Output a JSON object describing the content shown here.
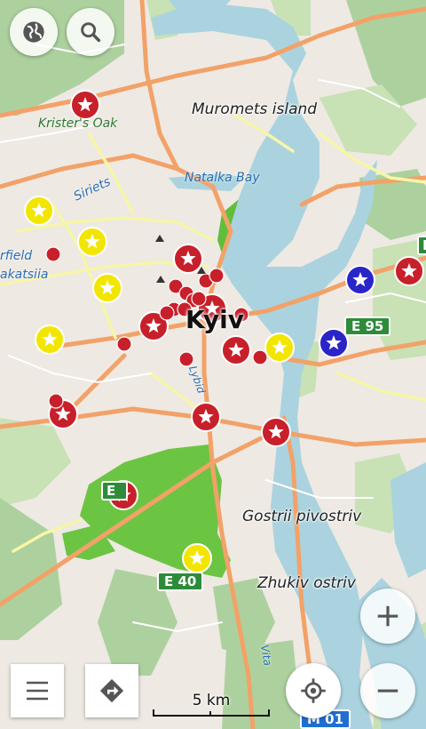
{
  "labels": {
    "muromets": "Muromets island",
    "kristers_oak": "Krister's Oak",
    "natalka_bay": "Natalka Bay",
    "siriets": "Siriets",
    "field": "rfield",
    "akatsiia": "akatsiia",
    "kyiv": "Kyiv",
    "lybid": "Lybid",
    "gostrii": "Gostrii pivostriv",
    "zhukiv": "Zhukiv ostriv",
    "vita": "Vita",
    "edge_m": "M"
  },
  "road_shields": {
    "e95": "E 95",
    "e40": "E 40",
    "e_left": "E",
    "m01": "M 01"
  },
  "scale": {
    "label": "5 km"
  },
  "controls": {
    "globe_icon": "globe-icon",
    "search_icon": "search-icon",
    "menu_icon": "hamburger-menu-icon",
    "directions_icon": "directions-icon",
    "locate_icon": "my-location-icon",
    "zoom_in_icon": "plus-icon",
    "zoom_out_icon": "minus-icon"
  },
  "markers": {
    "colors": {
      "red": "#c8202b",
      "yellow": "#f2e600",
      "blue": "#2a25c8"
    }
  }
}
